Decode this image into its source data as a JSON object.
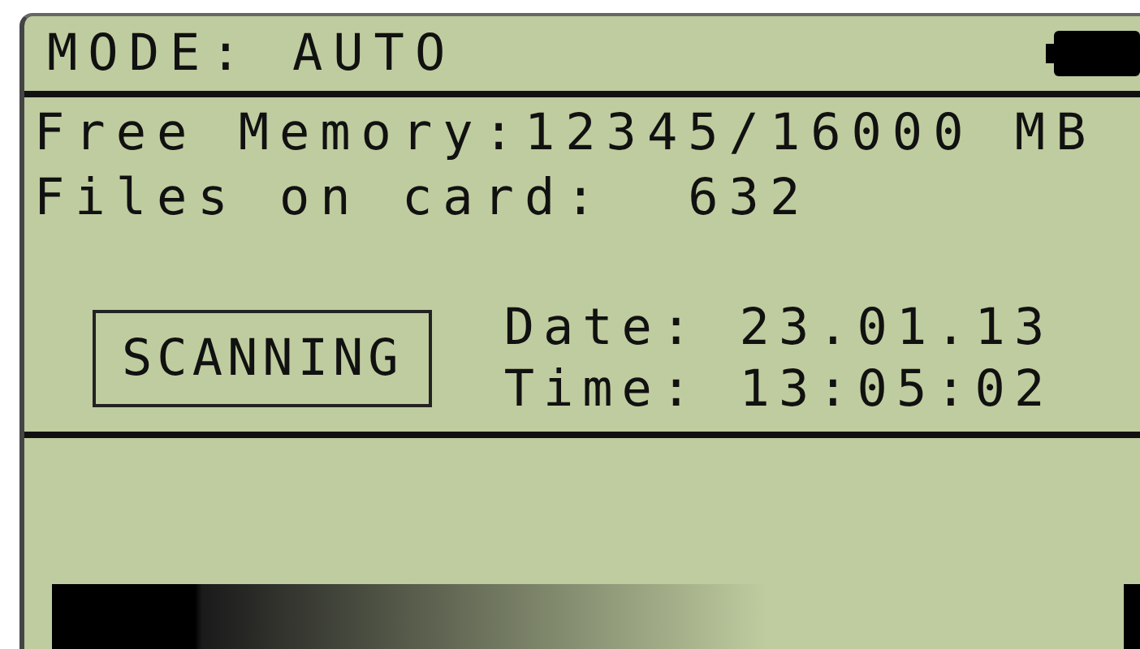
{
  "header": {
    "mode": "MODE: AUTO"
  },
  "info": [
    "Free Memory:12345/16000 MB",
    "Files on card:  632"
  ],
  "status": {
    "label": "SCANNING"
  },
  "datetime": [
    "Date: 23.01.13",
    "Time: 13:05:02"
  ]
}
